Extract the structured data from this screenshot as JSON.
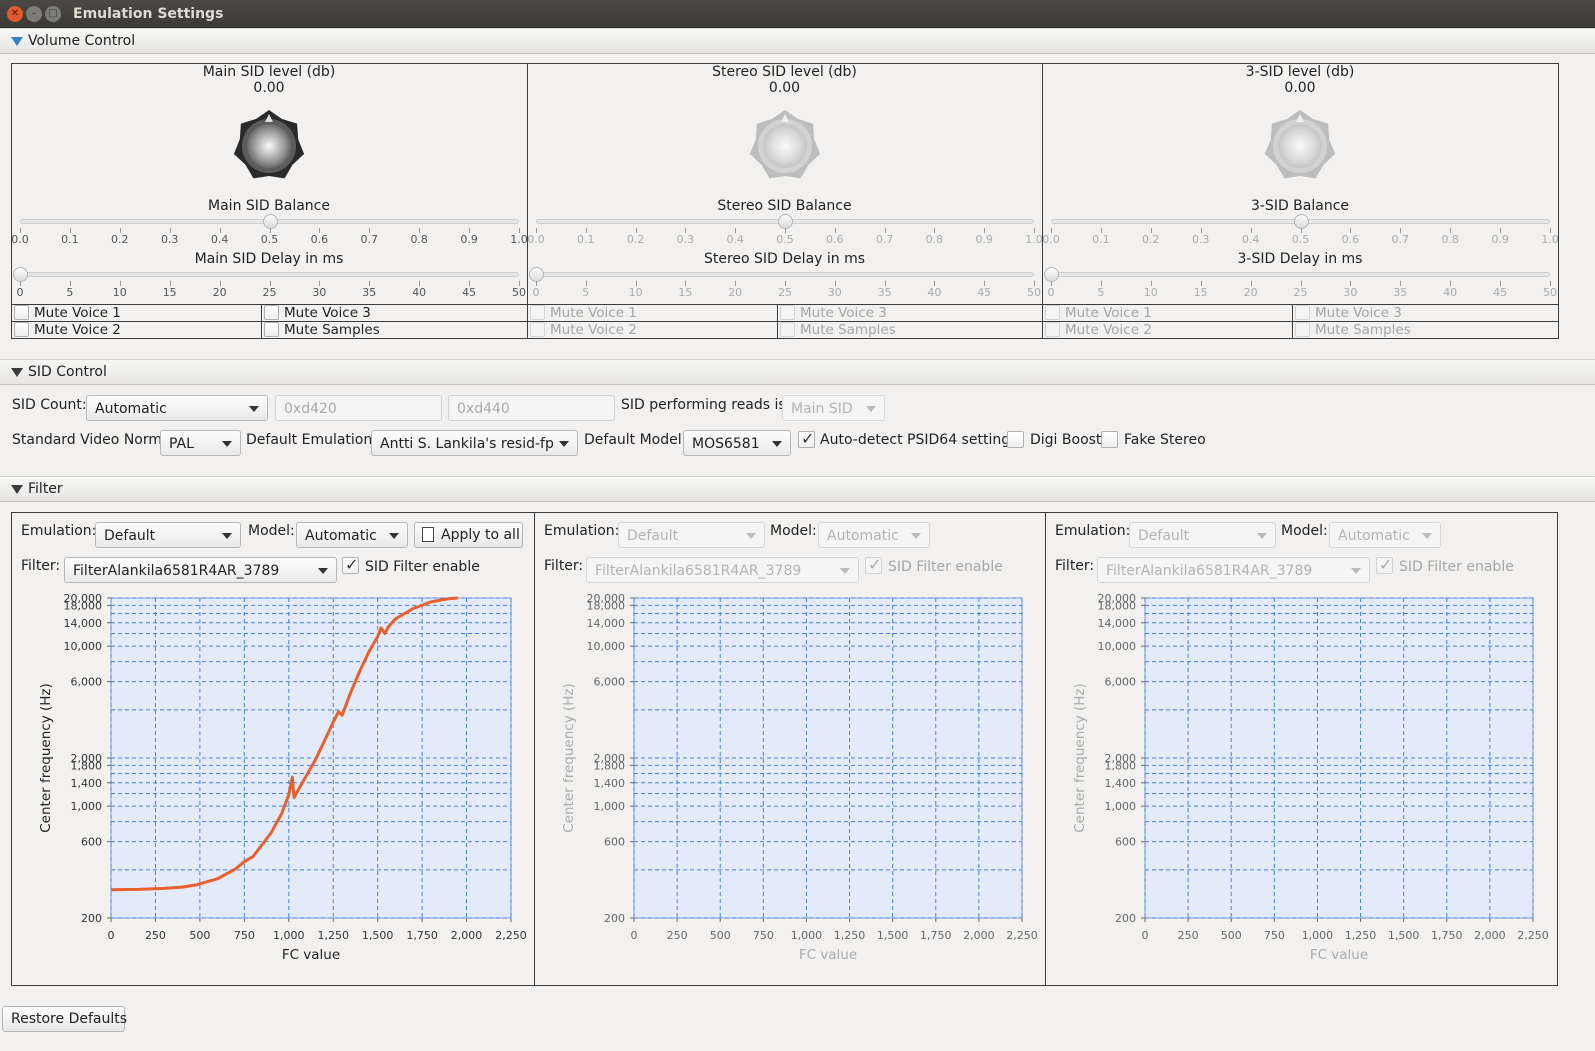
{
  "window": {
    "title": "Emulation Settings"
  },
  "sections": {
    "volume": "Volume Control",
    "sid": "SID Control",
    "filter": "Filter"
  },
  "volume_panels": [
    {
      "level_label": "Main SID level (db)",
      "level_value": "0.00",
      "balance_label": "Main SID Balance",
      "balance": 0.5,
      "delay_label": "Main SID Delay in ms",
      "delay": 0,
      "enabled": true,
      "mutes": [
        "Mute Voice 1",
        "Mute Voice 3",
        "Mute Voice 2",
        "Mute Samples"
      ]
    },
    {
      "level_label": "Stereo SID level (db)",
      "level_value": "0.00",
      "balance_label": "Stereo SID Balance",
      "balance": 0.5,
      "delay_label": "Stereo SID Delay in ms",
      "delay": 0,
      "enabled": false,
      "mutes": [
        "Mute Voice 1",
        "Mute Voice 3",
        "Mute Voice 2",
        "Mute Samples"
      ]
    },
    {
      "level_label": "3-SID level (db)",
      "level_value": "0.00",
      "balance_label": "3-SID Balance",
      "balance": 0.5,
      "delay_label": "3-SID Delay in ms",
      "delay": 0,
      "enabled": false,
      "mutes": [
        "Mute Voice 1",
        "Mute Voice 3",
        "Mute Voice 2",
        "Mute Samples"
      ]
    }
  ],
  "balance_ticks": [
    "0.0",
    "0.1",
    "0.2",
    "0.3",
    "0.4",
    "0.5",
    "0.6",
    "0.7",
    "0.8",
    "0.9",
    "1.0"
  ],
  "delay_ticks": [
    "0",
    "5",
    "10",
    "15",
    "20",
    "25",
    "30",
    "35",
    "40",
    "45",
    "50"
  ],
  "sid_control": {
    "sid_count_label": "SID Count:",
    "sid_count": "Automatic",
    "addr1": "0xd420",
    "addr2": "0xd440",
    "reads_label": "SID performing reads is:",
    "reads_value": "Main SID",
    "video_norm_label": "Standard Video Norm:",
    "video_norm": "PAL",
    "emulation_label": "Default Emulation:",
    "emulation": "Antti S. Lankila's resid-fp",
    "model_label": "Default Model:",
    "model": "MOS6581",
    "psid64_label": "Auto-detect PSID64 settings",
    "psid64": true,
    "digi_label": "Digi Boost",
    "digi": false,
    "fake_stereo_label": "Fake Stereo",
    "fake_stereo": false
  },
  "filter_panels": [
    {
      "emulation_label": "Emulation:",
      "emulation": "Default",
      "model_label": "Model:",
      "model": "Automatic",
      "apply_label": "Apply to all",
      "filter_label": "Filter:",
      "filter": "FilterAlankila6581R4AR_3789",
      "enable_label": "SID Filter enable",
      "enable": true,
      "enabled": true
    },
    {
      "emulation_label": "Emulation:",
      "emulation": "Default",
      "model_label": "Model:",
      "model": "Automatic",
      "filter_label": "Filter:",
      "filter": "FilterAlankila6581R4AR_3789",
      "enable_label": "SID Filter enable",
      "enable": true,
      "enabled": false
    },
    {
      "emulation_label": "Emulation:",
      "emulation": "Default",
      "model_label": "Model:",
      "model": "Automatic",
      "filter_label": "Filter:",
      "filter": "FilterAlankila6581R4AR_3789",
      "enable_label": "SID Filter enable",
      "enable": true,
      "enabled": false
    }
  ],
  "restore_label": "Restore Defaults",
  "chart_data": [
    {
      "type": "line",
      "xlabel": "FC value",
      "ylabel": "Center frequency (Hz)",
      "yscale": "log",
      "xlim": [
        0,
        2250
      ],
      "ylim": [
        200,
        20000
      ],
      "x_ticks": [
        "0",
        "250",
        "500",
        "750",
        "1,000",
        "1,250",
        "1,500",
        "1,750",
        "2,000",
        "2,250"
      ],
      "y_ticks": [
        "200",
        "600",
        "1,000",
        "1,400",
        "1,800",
        "2,000",
        "6,000",
        "10,000",
        "14,000",
        "18,000",
        "20,000"
      ],
      "grid": true,
      "color": "#e8602c",
      "series": [
        {
          "x": [
            0,
            150,
            300,
            400,
            480,
            520,
            600,
            700,
            750,
            800,
            900,
            960,
            1000,
            1020,
            1030,
            1060,
            1100,
            1150,
            1200,
            1250,
            1280,
            1300,
            1350,
            1400,
            1450,
            1500,
            1520,
            1540,
            1560,
            1600,
            1700,
            1800,
            1900,
            1950
          ],
          "y": [
            300,
            302,
            306,
            312,
            322,
            332,
            352,
            405,
            450,
            485,
            680,
            900,
            1180,
            1520,
            1130,
            1300,
            1560,
            1950,
            2550,
            3350,
            3900,
            3700,
            5200,
            7000,
            9200,
            11500,
            13000,
            12000,
            13200,
            14800,
            17200,
            18900,
            19800,
            20000
          ]
        }
      ]
    },
    {
      "type": "line",
      "xlabel": "FC value",
      "ylabel": "Center frequency (Hz)",
      "yscale": "log",
      "xlim": [
        0,
        2250
      ],
      "ylim": [
        200,
        20000
      ],
      "x_ticks": [
        "0",
        "250",
        "500",
        "750",
        "1,000",
        "1,250",
        "1,500",
        "1,750",
        "2,000",
        "2,250"
      ],
      "y_ticks": [
        "200",
        "600",
        "1,000",
        "1,400",
        "1,800",
        "2,000",
        "6,000",
        "10,000",
        "14,000",
        "18,000",
        "20,000"
      ],
      "grid": true,
      "series": []
    },
    {
      "type": "line",
      "xlabel": "FC value",
      "ylabel": "Center frequency (Hz)",
      "yscale": "log",
      "xlim": [
        0,
        2250
      ],
      "ylim": [
        200,
        20000
      ],
      "x_ticks": [
        "0",
        "250",
        "500",
        "750",
        "1,000",
        "1,250",
        "1,500",
        "1,750",
        "2,000",
        "2,250"
      ],
      "y_ticks": [
        "200",
        "600",
        "1,000",
        "1,400",
        "1,800",
        "2,000",
        "6,000",
        "10,000",
        "14,000",
        "18,000",
        "20,000"
      ],
      "grid": true,
      "series": []
    }
  ]
}
